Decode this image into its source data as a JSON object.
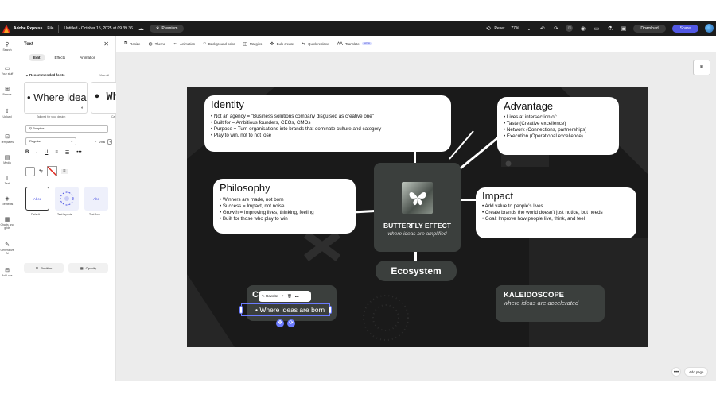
{
  "topbar": {
    "app_name": "Adobe Express",
    "file_menu": "File",
    "doc_title": "Untitled - October 15, 2025 at 09.39.36",
    "premium": "Premium",
    "reset": "Reset",
    "zoom": "77%",
    "download": "Download",
    "share": "Share"
  },
  "rail": {
    "items": [
      {
        "label": "Search",
        "icon": "search-icon"
      },
      {
        "label": "Your stuff",
        "icon": "folder-icon"
      },
      {
        "label": "Brands",
        "icon": "brand-icon"
      },
      {
        "label": "Upload",
        "icon": "upload-icon"
      },
      {
        "label": "Templates",
        "icon": "templates-icon"
      },
      {
        "label": "Media",
        "icon": "media-icon"
      },
      {
        "label": "Text",
        "icon": "text-icon"
      },
      {
        "label": "Elements",
        "icon": "elements-icon"
      },
      {
        "label": "Charts and grids",
        "icon": "chart-icon"
      },
      {
        "label": "Generative AI",
        "icon": "ai-icon"
      },
      {
        "label": "Add-ons",
        "icon": "addons-icon"
      }
    ]
  },
  "panel": {
    "title": "Text",
    "tabs": [
      "Edit",
      "Effects",
      "Animation"
    ],
    "recommended": "Recommended fonts",
    "view_all": "View all",
    "font_preview_1": "• Where idea",
    "font_preview_2": "• Wh",
    "font_caption_1": "Tailored for your design",
    "font_caption_2": "Cal",
    "font_family": "Poppins",
    "font_weight": "Regular",
    "font_size": "29.6",
    "styles": [
      {
        "label": "Default",
        "preview": "Abcd"
      },
      {
        "label": "Text layouts",
        "preview": ""
      },
      {
        "label": "Text flow",
        "preview": "Abc"
      }
    ],
    "position": "Position",
    "opacity": "Opacity"
  },
  "toolbar": {
    "items": [
      "Resize",
      "Theme",
      "Animation",
      "Background color",
      "Margins",
      "Bulk create",
      "Quick replace",
      "Translate"
    ],
    "new_badge": "NEW"
  },
  "workspace": {
    "more": "•••",
    "add_page": "Add page"
  },
  "canvas": {
    "identity": {
      "title": "Identity",
      "bullets": [
        "Not an agency = \"Business solutions company disguised as creative one\"",
        "Built for = Ambitious founders, CEOs, CMOs",
        "Purpose = Turn organisations into brands that dominate culture and category",
        "Play to win, not to not lose"
      ]
    },
    "advantage": {
      "title": "Advantage",
      "bullets": [
        "Lives at intersection of:",
        "Taste (Creative excellence)",
        "Network (Connections, partnerships)",
        "Execution (Operational excellence)"
      ]
    },
    "philosophy": {
      "title": "Philosophy",
      "bullets": [
        "Winners are made, not born",
        "Success = Impact, not noise",
        "Growth = Improving lives, thinking, feeling",
        "Built for those who play to win"
      ]
    },
    "impact": {
      "title": "Impact",
      "bullets": [
        "Add value to people's lives",
        "Create brands the world doesn't just notice, but needs",
        "Goal: Improve how people live, think, and feel"
      ]
    },
    "center": {
      "title": "BUTTERFLY EFFECT",
      "subtitle": "where ideas are amplified"
    },
    "ecosystem": "Ecosystem",
    "kaleidoscope": {
      "title": "KALEIDOSCOPE",
      "subtitle": "where ideas are accelerated"
    },
    "selected": {
      "partial_title": "C",
      "text": "• Where ideas are born",
      "toolbar_label": "Rewrite"
    }
  }
}
